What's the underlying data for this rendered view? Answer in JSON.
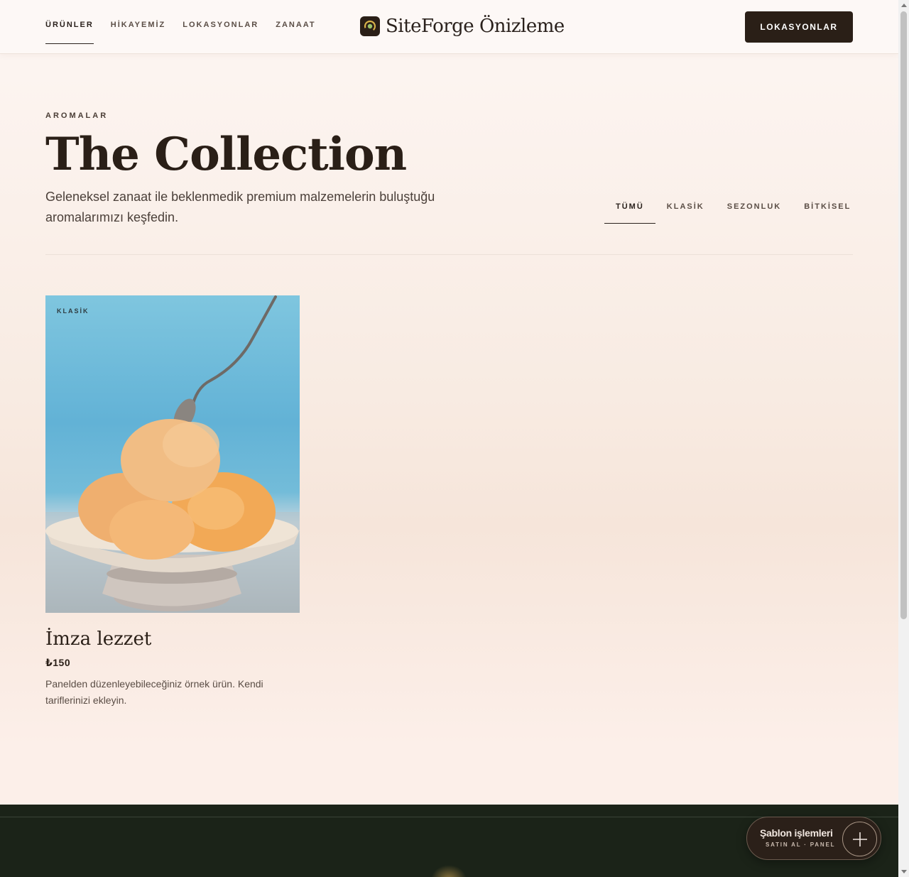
{
  "header": {
    "nav": [
      "ÜRÜNLER",
      "HİKAYEMİZ",
      "LOKASYONLAR",
      "ZANAAT"
    ],
    "brand": "SiteForge Önizleme",
    "cta_label": "LOKASYONLAR"
  },
  "hero": {
    "eyebrow": "AROMALAR",
    "title": "The Collection",
    "subtitle": "Geleneksel zanaat ile beklenmedik premium malzemelerin buluştuğu aromalarımızı keşfedin."
  },
  "filters": [
    "TÜMÜ",
    "KLASİK",
    "SEZONLUK",
    "BİTKİSEL"
  ],
  "products": [
    {
      "tag": "KLASİK",
      "name": "İmza lezzet",
      "price": "₺150",
      "description": "Panelden düzenleyebileceğiniz örnek ürün. Kendi tariflerinizi ekleyin."
    }
  ],
  "widget": {
    "title": "Şablon işlemleri",
    "subtitle": "SATIN AL · PANEL"
  },
  "colors": {
    "accent_dark": "#2a1f17",
    "footer": "#1b2318",
    "image_sky": "#62b2d6"
  }
}
